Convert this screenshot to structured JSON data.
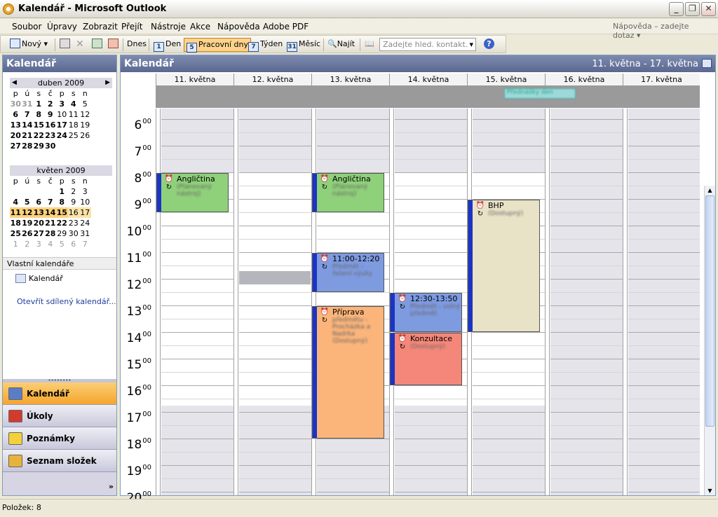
{
  "window": {
    "title": "Kalendář - Microsoft Outlook"
  },
  "menu": {
    "items": [
      "Soubor",
      "Úpravy",
      "Zobrazit",
      "Přejít",
      "Nástroje",
      "Akce",
      "Nápověda",
      "Adobe PDF"
    ],
    "help_placeholder": "Nápověda – zadejte dotaz"
  },
  "toolbar": {
    "new_label": "Nový",
    "today_label": "Dnes",
    "day_label": "Den",
    "day_num": "1",
    "workweek_label": "Pracovní dny",
    "workweek_num": "5",
    "week_label": "Týden",
    "week_num": "7",
    "month_label": "Měsíc",
    "month_num": "31",
    "find_label": "Najít",
    "contact_placeholder": "Zadejte hled. kontakt."
  },
  "left_pane": {
    "title": "Kalendář",
    "own_calendars": "Vlastní kalendáře",
    "calendar_item": "Kalendář",
    "open_shared": "Otevřít sdílený kalendář..."
  },
  "mini_calendars": [
    {
      "title": "duben 2009",
      "day_headers": [
        "p",
        "ú",
        "s",
        "č",
        "p",
        "s",
        "n"
      ],
      "weeks": [
        [
          "30",
          "31",
          "1",
          "2",
          "3",
          "4",
          "5"
        ],
        [
          "6",
          "7",
          "8",
          "9",
          "10",
          "11",
          "12"
        ],
        [
          "13",
          "14",
          "15",
          "16",
          "17",
          "18",
          "19"
        ],
        [
          "20",
          "21",
          "22",
          "23",
          "24",
          "25",
          "26"
        ],
        [
          "27",
          "28",
          "29",
          "30",
          "",
          "",
          ""
        ]
      ]
    },
    {
      "title": "květen 2009",
      "day_headers": [
        "p",
        "ú",
        "s",
        "č",
        "p",
        "s",
        "n"
      ],
      "weeks": [
        [
          "",
          "",
          "",
          "",
          "1",
          "2",
          "3"
        ],
        [
          "4",
          "5",
          "6",
          "7",
          "8",
          "9",
          "10"
        ],
        [
          "11",
          "12",
          "13",
          "14",
          "15",
          "16",
          "17"
        ],
        [
          "18",
          "19",
          "20",
          "21",
          "22",
          "23",
          "24"
        ],
        [
          "25",
          "26",
          "27",
          "28",
          "29",
          "30",
          "31"
        ],
        [
          "1",
          "2",
          "3",
          "4",
          "5",
          "6",
          "7"
        ]
      ]
    }
  ],
  "nav_buttons": [
    {
      "label": "Kalendář",
      "icon": "calendar-icon",
      "color": "#5b7dc6"
    },
    {
      "label": "Úkoly",
      "icon": "tasks-icon",
      "color": "#d23b2b"
    },
    {
      "label": "Poznámky",
      "icon": "notes-icon",
      "color": "#f4d13b"
    },
    {
      "label": "Seznam složek",
      "icon": "folder-icon",
      "color": "#e9b23a"
    }
  ],
  "main": {
    "title": "Kalendář",
    "date_range": "11. května - 17. května",
    "days": [
      "11. května",
      "12. května",
      "13. května",
      "14. května",
      "15. května",
      "16. května",
      "17. května"
    ],
    "hours": [
      "6",
      "7",
      "8",
      "9",
      "10",
      "11",
      "12",
      "13",
      "14",
      "15",
      "16",
      "17",
      "18",
      "19",
      "20"
    ],
    "hour_suffix": "00"
  },
  "events": [
    {
      "title": "Angličtina",
      "day": 0,
      "start": 8.0,
      "end": 9.5,
      "color": "#8fd07a",
      "subtitle": "(Plánovaný nástroj)"
    },
    {
      "title": "Angličtina",
      "day": 2,
      "start": 8.0,
      "end": 9.5,
      "color": "#8fd07a",
      "subtitle": "(Plánovaný nástroj)"
    },
    {
      "title": "11:00-12:20",
      "day": 2,
      "start": 11.0,
      "end": 12.5,
      "color": "#7e9be0",
      "subtitle": "Předmět - řešení výuky"
    },
    {
      "title": "12:30-13:50",
      "day": 3,
      "start": 12.5,
      "end": 14.0,
      "color": "#7e9be0",
      "subtitle": "Předmět - volný předmět"
    },
    {
      "title": "Konzultace",
      "day": 3,
      "start": 14.0,
      "end": 16.0,
      "color": "#f4877a",
      "subtitle": "(Dostupný)"
    },
    {
      "title": "Příprava",
      "day": 2,
      "start": 13.0,
      "end": 18.0,
      "color": "#fbb57a",
      "subtitle": "předmětu - Procházka a Nadrka (Dostupný)"
    },
    {
      "title": "BHP",
      "day": 4,
      "start": 9.0,
      "end": 14.0,
      "color": "#e8e2c6",
      "subtitle": "(Dostupný)"
    }
  ],
  "allday_event": {
    "title": "Přednášky den"
  },
  "status": {
    "items_label": "Položek: 8"
  }
}
